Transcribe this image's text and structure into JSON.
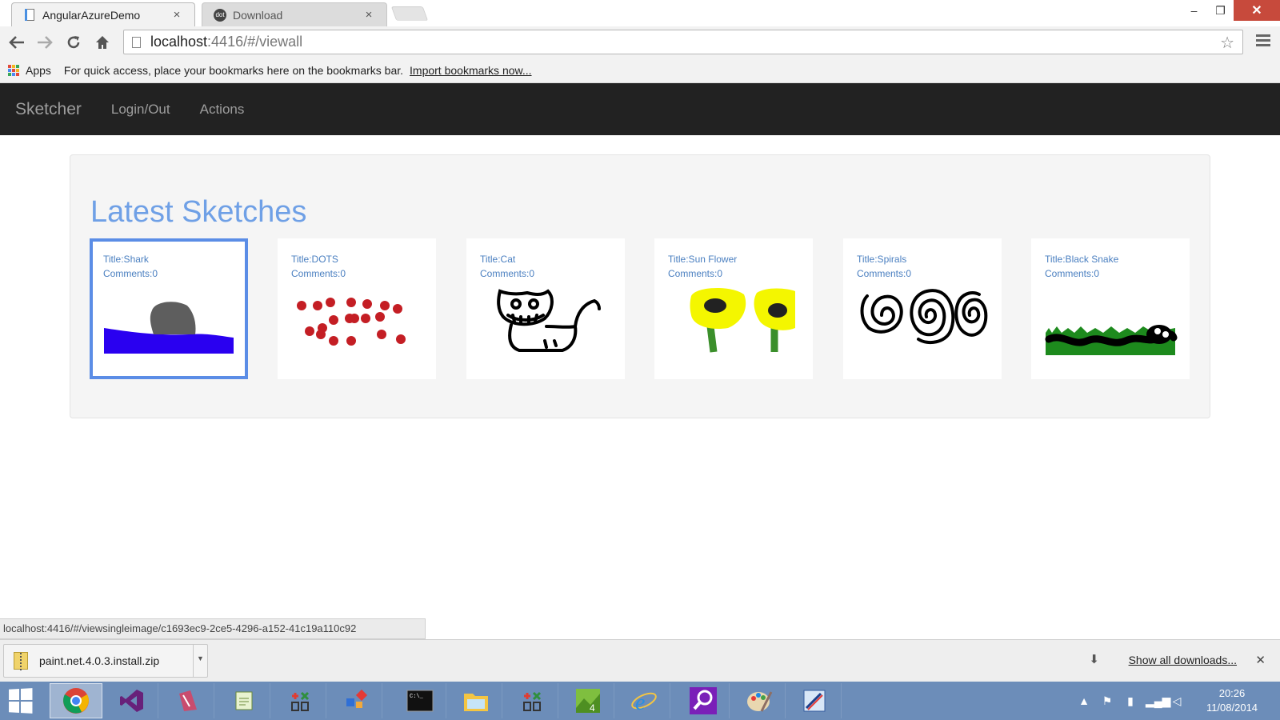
{
  "browser": {
    "tabs": [
      {
        "title": "AngularAzureDemo",
        "active": true,
        "icon": "page-icon"
      },
      {
        "title": "Download",
        "active": false,
        "icon": "dotnet-icon"
      }
    ],
    "tab_close_glyph": "×",
    "window_controls": {
      "minimize": "–",
      "maximize": "❐",
      "close": "✕"
    },
    "url_host": "localhost",
    "url_path": ":4416/#/viewall",
    "bookmarks_bar": {
      "apps_label": "Apps",
      "message": "For quick access, place your bookmarks here on the bookmarks bar.",
      "import_link": "Import bookmarks now..."
    },
    "status_url": "localhost:4416/#/viewsingleimage/c1693ec9-2ce5-4296-a152-41c19a110c92"
  },
  "app": {
    "brand": "Sketcher",
    "nav": [
      {
        "label": "Login/Out"
      },
      {
        "label": "Actions"
      }
    ],
    "heading": "Latest Sketches",
    "sketches": [
      {
        "title": "Title:Shark",
        "comments": "Comments:0",
        "selected": true
      },
      {
        "title": "Title:DOTS",
        "comments": "Comments:0",
        "selected": false
      },
      {
        "title": "Title:Cat",
        "comments": "Comments:0",
        "selected": false
      },
      {
        "title": "Title:Sun Flower",
        "comments": "Comments:0",
        "selected": false
      },
      {
        "title": "Title:Spirals",
        "comments": "Comments:0",
        "selected": false
      },
      {
        "title": "Title:Black Snake",
        "comments": "Comments:0",
        "selected": false
      }
    ]
  },
  "downloads": {
    "file": "paint.net.4.0.3.install.zip",
    "show_all": "Show all downloads...",
    "close_glyph": "✕"
  },
  "taskbar": {
    "apps": [
      "chrome-icon",
      "visual-studio-icon",
      "azure-icon",
      "notepad-icon",
      "tool-icon",
      "apps-icon",
      "console-icon",
      "explorer-icon",
      "tool-icon",
      "minecraft-icon",
      "ie-icon",
      "search-icon",
      "paint-icon",
      "paint-net-icon"
    ],
    "time": "20:26",
    "date": "11/08/2014"
  },
  "colors": {
    "navbar": "#222222",
    "heading": "#6fa0e6",
    "caption": "#4a7fc0",
    "selected_border": "#5b8de6",
    "taskbar": "#6c8db9"
  }
}
